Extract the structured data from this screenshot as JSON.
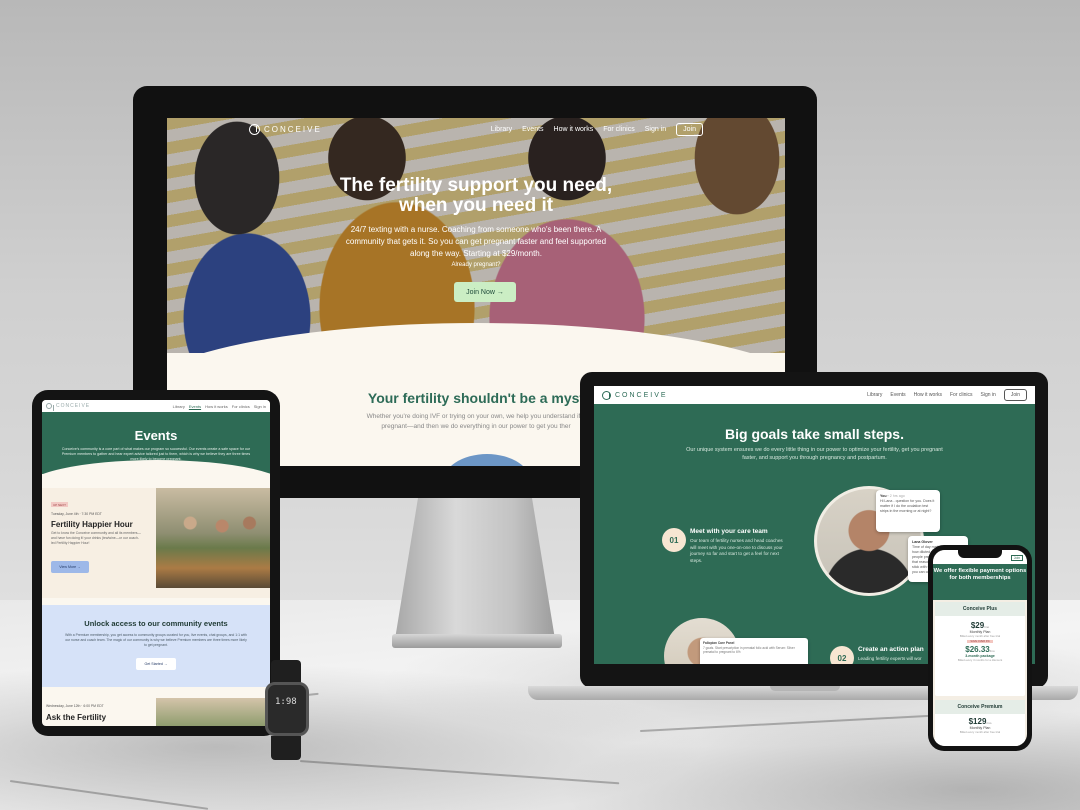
{
  "colors": {
    "brand_green": "#2e6b55",
    "cream": "#fbf7ef",
    "cta_mint": "#cbeec4",
    "tablet_blue": "#d6e2f8",
    "view_button_blue": "#9db8e8"
  },
  "brand": {
    "logo_text": "CONCEIVE",
    "logo_icon": "conceive-logo-icon"
  },
  "desktop": {
    "nav": [
      "Library",
      "Events",
      "How it works",
      "For clinics",
      "Sign in"
    ],
    "join": "Join",
    "hero_title": "The fertility support you need, when you need it",
    "hero_subtitle": "24/7 texting with a nurse. Coaching from someone who's been there. A community that gets it. So you can get pregnant faster and feel supported along the way. Starting at $29/month.",
    "already_pregnant": "Already pregnant?",
    "cta": "Join Now →",
    "section_title": "Your fertility shouldn't be a myst",
    "section_sub": "Whether you're doing IVF or trying on your own, we help you understand if y pregnant—and then we do everything in our power to get you ther"
  },
  "tablet": {
    "nav": [
      "Library",
      "Events",
      "How it works",
      "For clinics",
      "Sign in"
    ],
    "title": "Events",
    "subtitle": "Conceive's community is a core part of what makes our program so successful. Our events create a safe space for our Premium members to gather and hear expert advice tailored just to them, which is why we believe they are three times more likely to become pregnant.",
    "tag": "UP NEXT",
    "event1_date": "Tuesday, June 4th · 7:30 PM EDT",
    "event1_title": "Fertility Happier Hour",
    "event1_desc": "Get to know the Conceive community and all its members—and have fun doing it! your drinks (tea/wine—or our coach-led Fertility Happier Hour!",
    "view_more": "View More →",
    "community_title": "Unlock access to our community events",
    "community_desc": "With a Premium membership, you get access to community groups curated for you, live events, chat groups, and 1:1 with our nurse and coach team. The magic of our community is why we believe Premium members are three times more likely to get pregnant.",
    "get_started": "Get Started →",
    "event2_date": "Wednesday, June 12th · 6:00 PM EDT",
    "event2_title": "Ask the Fertility"
  },
  "watch": {
    "time": "1:98"
  },
  "laptop": {
    "nav": [
      "Library",
      "Events",
      "How it works",
      "For clinics",
      "Sign in"
    ],
    "join": "Join",
    "title": "Big goals take small steps.",
    "subtitle": "Our unique system ensures we do every little thing in our power to optimize your fertility, get you pregnant faster, and support you through pregnancy and postpartum.",
    "step1_num": "01",
    "step1_title": "Meet with your care team",
    "step1_desc": "Our team of fertility nurses and head coaches will meet with you one-on-one to discuss your journey so far and start to get a feel for next steps.",
    "chat1_name": "You",
    "chat1_time": "2 hrs ago",
    "chat1_text": "Hi Lana - question for you. Does it matter if I do the ovulation test strips in the morning or at night?",
    "chat2_name": "Lana Glover",
    "chat2_text": "Time of day matters less than how diluted your urine is. Most people prefer the morning for that reason. Once you decide, stick with that time every day so you can compare your results.",
    "step2_num": "02",
    "step2_title": "Create an action plan",
    "step2_desc": "Leading fertility experts will wor",
    "card3_text": "7 goals. Start prescription in prenatal folic acid with Serum: Silver prenatal to pregnant to 6%",
    "card3_label": "Fallopian Care Panel"
  },
  "phone": {
    "join": "Join",
    "title": "We offer flexible payment options for both memberships",
    "plan1_name": "Conceive Plus",
    "plan1_price": "$29",
    "plan1_per": "/mo",
    "plan1_label": "Monthly Plan",
    "plan1_fine": "Billed every month after free trial",
    "badge": "SAVE OVER 9%",
    "plan1b_price": "$26.33",
    "plan1b_per": "/mo",
    "plan1b_label": "3-month package",
    "plan1b_fine": "Billed every 3 months for a discount",
    "plan2_name": "Conceive Premium",
    "plan2_price": "$129",
    "plan2_per": "/mo",
    "plan2_label": "Monthly Plan",
    "plan2_fine": "Billed every month after free trial"
  }
}
